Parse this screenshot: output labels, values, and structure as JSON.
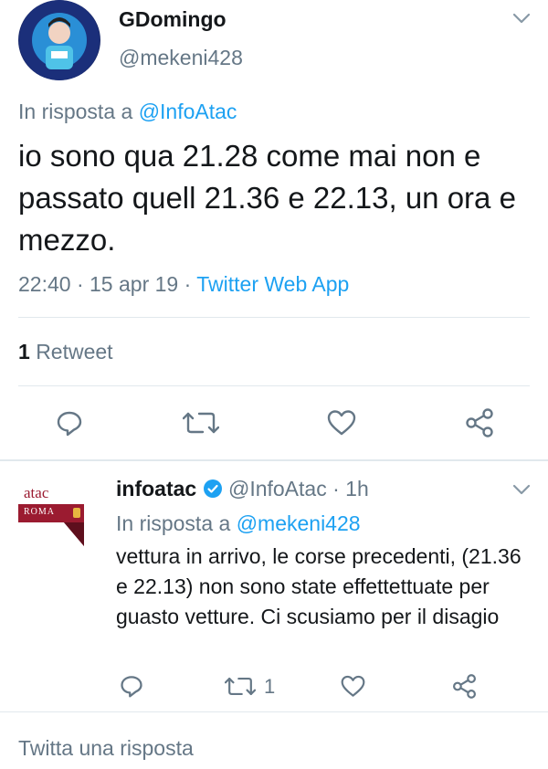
{
  "main_tweet": {
    "display_name": "GDomingo",
    "handle": "@mekeni428",
    "reply_prefix": "In risposta a",
    "reply_to": "@InfoAtac",
    "text": "io sono qua 21.28 come mai non e passato quell 21.36 e 22.13, un ora e mezzo.",
    "time": "22:40",
    "date": "15 apr 19",
    "source": "Twitter Web App",
    "retweet_count": "1",
    "retweet_label": "Retweet"
  },
  "reply_tweet": {
    "display_name": "infoatac",
    "handle": "@InfoAtac",
    "time_ago": "1h",
    "reply_prefix": "In risposta a",
    "reply_to": "@mekeni428",
    "text": "vettura in arrivo, le corse precedenti, (21.36 e 22.13) non sono state effettettuate per guasto vetture. Ci scusiamo per il disagio",
    "retweet_count": "1",
    "logo_text": "atac",
    "logo_sub": "ROMA"
  },
  "compose": {
    "placeholder": "Twitta una risposta"
  },
  "icons": {
    "reply": "reply-icon",
    "retweet": "retweet-icon",
    "like": "heart-icon",
    "share": "share-icon",
    "menu": "chevron-down-icon",
    "verified": "verified-badge-icon"
  },
  "colors": {
    "accent": "#1da1f2",
    "secondary_text": "#657786",
    "atac_red": "#9b1b30"
  }
}
